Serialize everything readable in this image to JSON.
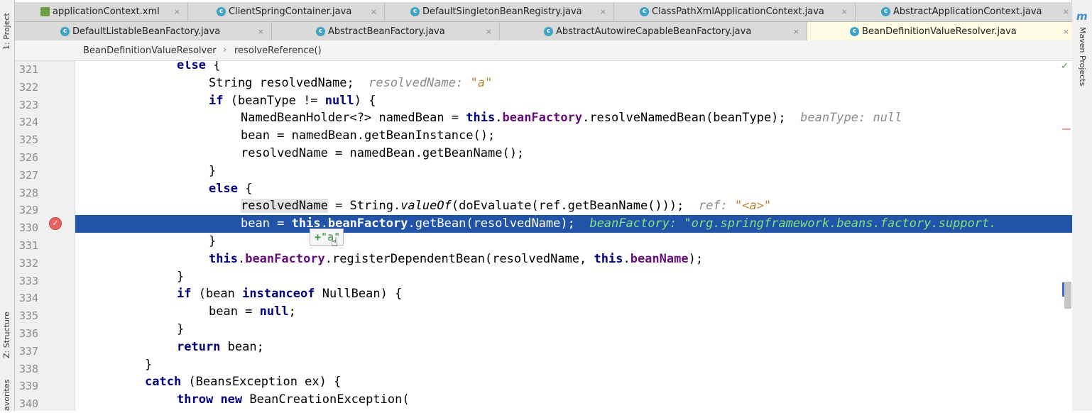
{
  "left_strip": {
    "project_label": "1: Project",
    "structure_label": "Z: Structure",
    "favorites_label": "avorites"
  },
  "right_strip": {
    "maven_label": "Maven Projects",
    "maven_icon_glyph": "m"
  },
  "tabs_row1": [
    {
      "label": "applicationContext.xml",
      "icon": "xml-file-icon"
    },
    {
      "label": "ClientSpringContainer.java",
      "icon": "class-icon"
    },
    {
      "label": "DefaultSingletonBeanRegistry.java",
      "icon": "class-icon"
    },
    {
      "label": "ClassPathXmlApplicationContext.java",
      "icon": "class-icon"
    },
    {
      "label": "AbstractApplicationContext.java",
      "icon": "class-icon"
    }
  ],
  "tabs_row2": [
    {
      "label": "DefaultListableBeanFactory.java",
      "icon": "class-icon"
    },
    {
      "label": "AbstractBeanFactory.java",
      "icon": "class-icon"
    },
    {
      "label": "AbstractAutowireCapableBeanFactory.java",
      "icon": "class-icon"
    },
    {
      "label": "BeanDefinitionValueResolver.java",
      "icon": "class-icon",
      "active": true
    }
  ],
  "close_glyph": "×",
  "class_icon_glyph": "c",
  "breadcrumb": {
    "class_name": "BeanDefinitionValueResolver",
    "separator": "›",
    "method_name": "resolveReference()"
  },
  "line_numbers": [
    "321",
    "322",
    "323",
    "324",
    "325",
    "326",
    "327",
    "328",
    "329",
    "330",
    "331",
    "332",
    "333",
    "334",
    "335",
    "336",
    "337",
    "338",
    "339",
    "340"
  ],
  "code": {
    "l321_else": "else",
    "l321_brace": " {",
    "l322_code": "String resolvedName;  ",
    "l322_hint": "resolvedName: ",
    "l322_hint_val": "\"a\"",
    "l323_if": "if",
    "l323_a": " (beanType != ",
    "l323_null": "null",
    "l323_b": ") {",
    "l324_a": "NamedBeanHolder<?> namedBean = ",
    "l324_this": "this",
    "l324_dot": ".",
    "l324_field": "beanFactory",
    "l324_b": ".resolveNamedBean(beanType);  ",
    "l324_hint": "beanType: null",
    "l325": "bean = namedBean.getBeanInstance();",
    "l326": "resolvedName = namedBean.getBeanName();",
    "l327": "}",
    "l328_else": "else",
    "l328_brace": " {",
    "l329_var": "resolvedName",
    "l329_a": " = String.",
    "l329_method": "valueOf",
    "l329_b": "(doEvaluate(ref.getBeanName()));  ",
    "l329_hint": "ref: ",
    "l329_hint_val": "\"<a>\"",
    "l330_a": "bean = ",
    "l330_this": "this",
    "l330_dot": ".",
    "l330_field": "beanFactory",
    "l330_b": ".getBean(resolvedName);  ",
    "l330_hint": "beanFactory: \"org.springframework.beans.factory.support.",
    "l331": "}",
    "l332_this": "this",
    "l332_dot": ".",
    "l332_field": "beanFactory",
    "l332_a": ".registerDependentBean(resolvedName, ",
    "l332_this2": "this",
    "l332_dot2": ".",
    "l332_field2": "beanName",
    "l332_b": ");",
    "l333": "}",
    "l334_if": "if",
    "l334_a": " (bean ",
    "l334_inst": "instanceof",
    "l334_b": " NullBean) {",
    "l335_a": "bean = ",
    "l335_null": "null",
    "l335_b": ";",
    "l336": "}",
    "l337_ret": "return",
    "l337_a": " bean;",
    "l338": "}",
    "l339_catch": "catch",
    "l339_a": " (BeansException ex) {",
    "l340_throw": "throw",
    "l340_new": "new",
    "l340_a": " BeanCreationException("
  },
  "tooltip": {
    "plus": "+",
    "value": "\"a\""
  },
  "breakpoint_glyph": "✓",
  "check_glyph": "✓",
  "cursor_glyph": "☝"
}
